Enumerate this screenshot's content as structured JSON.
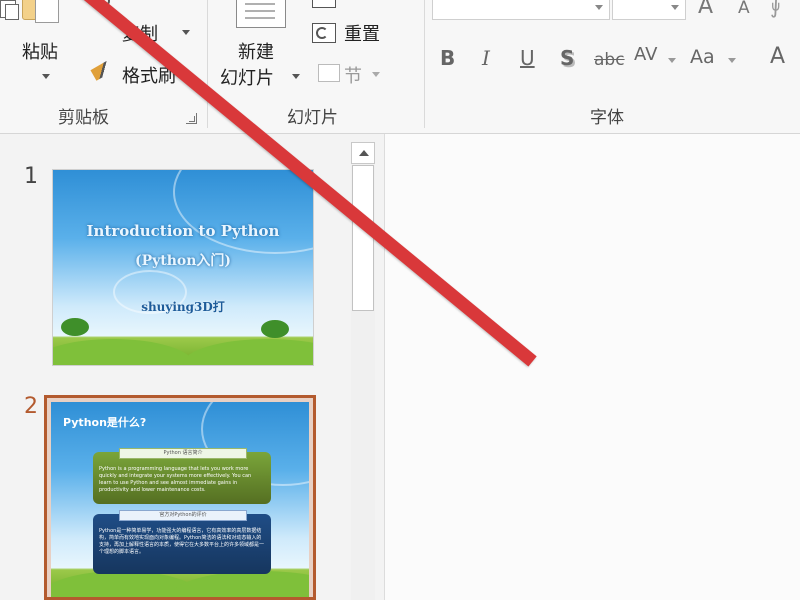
{
  "ribbon": {
    "clipboard": {
      "paste_label": "粘贴",
      "copy_label": "复制",
      "format_painter_label": "格式刷",
      "group_label": "剪贴板"
    },
    "slides": {
      "new_slide_label_line1": "新建",
      "new_slide_label_line2": "幻灯片",
      "reset_label": "重置",
      "section_label": "节",
      "group_label": "幻灯片"
    },
    "font": {
      "group_label": "字体",
      "bold": "B",
      "italic": "I",
      "underline": "U",
      "shadow": "S",
      "strikethrough": "abc",
      "spacing": "AV",
      "change_case": "Aa",
      "grow_font": "A",
      "shrink_font": "A",
      "font_color": "A"
    }
  },
  "thumbnails": [
    {
      "number": "1",
      "title": "Introduction to Python",
      "subtitle": "(Python入门)",
      "author": "shuying3D打"
    },
    {
      "number": "2",
      "title": "Python是什么?",
      "box1_header": "Python 语言简介",
      "box1_text": "Python is a programming language that lets you work more quickly and integrate your systems more effectively. You can learn to use Python and see almost immediate gains in productivity and lower maintenance costs.",
      "box2_header": "官方对Python的评价",
      "box2_text": "Python是一种简单易学，功能强大的编程语言，它有高效率的高层数据结构，简单而有效地实现面向对象编程。Python简洁的语法和对动态输入的支持，再加上解释性语言的本质，使得它在大多数平台上的许多领域都是一个理想的脚本语言。"
    }
  ],
  "colors": {
    "annotation_arrow": "#d9383a",
    "selected_slide_border": "#b35a2e"
  }
}
